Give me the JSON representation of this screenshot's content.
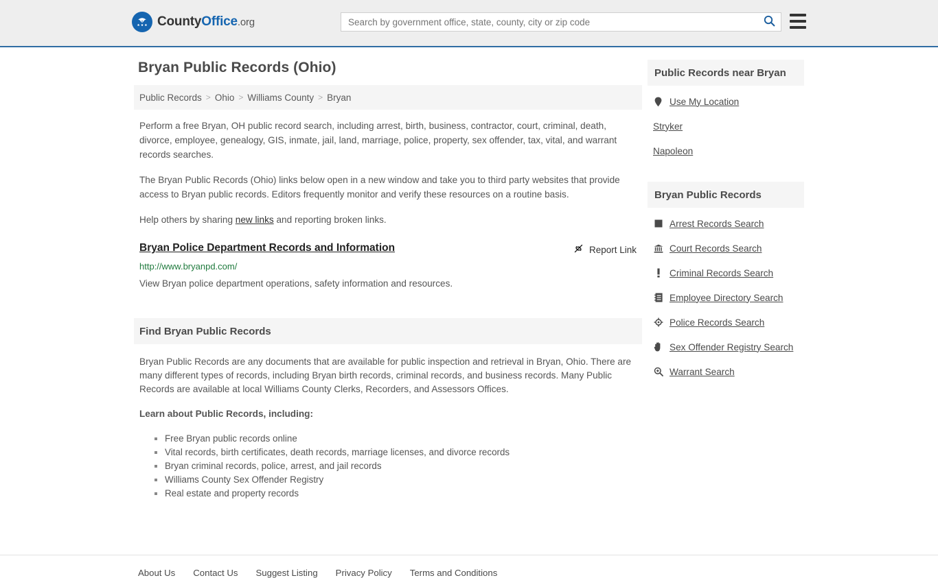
{
  "header": {
    "logo": {
      "text_county": "County",
      "text_office": "Office",
      "text_suffix": ".org",
      "icon": "eagle-seal-icon"
    },
    "search": {
      "placeholder": "Search by government office, state, county, city or zip code",
      "value": "",
      "search_icon": "search-icon"
    },
    "menu_icon": "hamburger-menu-icon"
  },
  "page": {
    "title": "Bryan Public Records (Ohio)"
  },
  "breadcrumb": {
    "separator": ">",
    "items": [
      {
        "label": "Public Records",
        "current": false
      },
      {
        "label": "Ohio",
        "current": false
      },
      {
        "label": "Williams County",
        "current": false
      },
      {
        "label": "Bryan",
        "current": true
      }
    ]
  },
  "intro": {
    "paragraph_1": "Perform a free Bryan, OH public record search, including arrest, birth, business, contractor, court, criminal, death, divorce, employee, genealogy, GIS, inmate, jail, land, marriage, police, property, sex offender, tax, vital, and warrant records searches.",
    "paragraph_2": "The Bryan Public Records (Ohio) links below open in a new window and take you to third party websites that provide access to Bryan public records. Editors frequently monitor and verify these resources on a routine basis.",
    "help_prefix": "Help others by sharing ",
    "help_link": "new links",
    "help_suffix": " and reporting broken links."
  },
  "listing": {
    "title": "Bryan Police Department Records and Information",
    "url": "http://www.bryanpd.com/",
    "description": "View Bryan police department operations, safety information and resources.",
    "report_label": "Report Link",
    "report_icon": "broken-link-icon"
  },
  "find_section": {
    "heading": "Find Bryan Public Records",
    "paragraph": "Bryan Public Records are any documents that are available for public inspection and retrieval in Bryan, Ohio. There are many different types of records, including Bryan birth records, criminal records, and business records. Many Public Records are available at local Williams County Clerks, Recorders, and Assessors Offices.",
    "learn_heading": "Learn about Public Records, including:",
    "bullets": [
      "Free Bryan public records online",
      "Vital records, birth certificates, death records, marriage licenses, and divorce records",
      "Bryan criminal records, police, arrest, and jail records",
      "Williams County Sex Offender Registry",
      "Real estate and property records"
    ]
  },
  "sidebar": {
    "near_panel": {
      "heading": "Public Records near Bryan",
      "items": [
        {
          "label": "Use My Location",
          "icon": "map-pin-icon"
        },
        {
          "label": "Stryker",
          "icon": ""
        },
        {
          "label": "Napoleon",
          "icon": ""
        }
      ]
    },
    "records_panel": {
      "heading": "Bryan Public Records",
      "items": [
        {
          "label": "Arrest Records Search",
          "icon": "fingerprint-icon"
        },
        {
          "label": "Court Records Search",
          "icon": "courthouse-icon"
        },
        {
          "label": "Criminal Records Search",
          "icon": "exclamation-icon"
        },
        {
          "label": "Employee Directory Search",
          "icon": "address-book-icon"
        },
        {
          "label": "Police Records Search",
          "icon": "police-badge-icon"
        },
        {
          "label": "Sex Offender Registry Search",
          "icon": "hand-stop-icon"
        },
        {
          "label": "Warrant Search",
          "icon": "magnifier-plus-icon"
        }
      ]
    }
  },
  "footer": {
    "links": [
      "About Us",
      "Contact Us",
      "Suggest Listing",
      "Privacy Policy",
      "Terms and Conditions"
    ]
  },
  "colors": {
    "header_bg": "#eeeeee",
    "header_border": "#2f6ca3",
    "brand_blue": "#1565b0",
    "panel_bg": "#f5f5f5",
    "url_green": "#1f7a3d",
    "body_text": "#555555"
  }
}
